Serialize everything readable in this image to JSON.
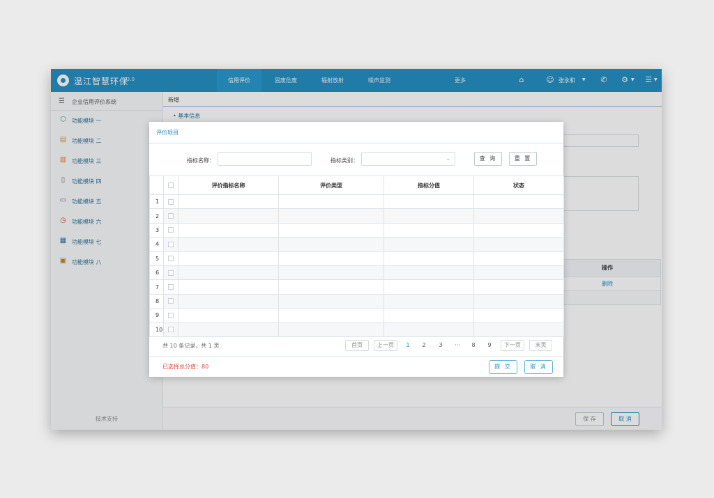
{
  "app": {
    "brand": "温江智慧环保",
    "version": "V3.0",
    "nav": [
      "信用评价",
      "固废危废",
      "辐射放射",
      "噪声监测",
      "更多"
    ],
    "user_name": "张永和",
    "accent_color": "#1f8bbf"
  },
  "sidebar": {
    "title": "企业信用评价系统",
    "items": [
      {
        "label": "功能模块 一",
        "icon": "cube-icon",
        "color": "#2e9c7a"
      },
      {
        "label": "功能模块 二",
        "icon": "document-icon",
        "color": "#caa13a"
      },
      {
        "label": "功能模块 三",
        "icon": "file-icon",
        "color": "#e07a32"
      },
      {
        "label": "功能模块 四",
        "icon": "page-icon",
        "color": "#777777"
      },
      {
        "label": "功能模块 五",
        "icon": "folder-icon",
        "color": "#8a4fa8"
      },
      {
        "label": "功能模块 六",
        "icon": "clock-icon",
        "color": "#e0453c"
      },
      {
        "label": "功能模块 七",
        "icon": "org-icon",
        "color": "#2c6f96"
      },
      {
        "label": "功能模块 八",
        "icon": "briefcase-icon",
        "color": "#b5822a"
      }
    ],
    "footer": "技术支持"
  },
  "main": {
    "breadcrumb": "新增",
    "section": "• 基本信息",
    "table_header": "操作",
    "table_action": "删除",
    "save_label": "保 存",
    "cancel_label": "取 消"
  },
  "modal": {
    "title": "评价项目",
    "filter": {
      "name_label": "指标名称：",
      "name_placeholder": "",
      "type_label": "指标类别：",
      "type_value": "",
      "query_label": "查 询",
      "reset_label": "重 置"
    },
    "columns": [
      "评价指标名称",
      "评价类型",
      "指标分值",
      "状态"
    ],
    "rows": [
      "1",
      "2",
      "3",
      "4",
      "5",
      "6",
      "7",
      "8",
      "9",
      "10"
    ],
    "pager": {
      "info": "共 10 条记录，共 1 页",
      "first": "首页",
      "prev": "上一页",
      "pages": [
        "1",
        "2",
        "3",
        "···",
        "8",
        "9"
      ],
      "current": "1",
      "next": "下一页",
      "last": "末页"
    },
    "selected_score": "已选择总分值：80",
    "submit_label": "提 交",
    "cancel_label": "取 消"
  }
}
